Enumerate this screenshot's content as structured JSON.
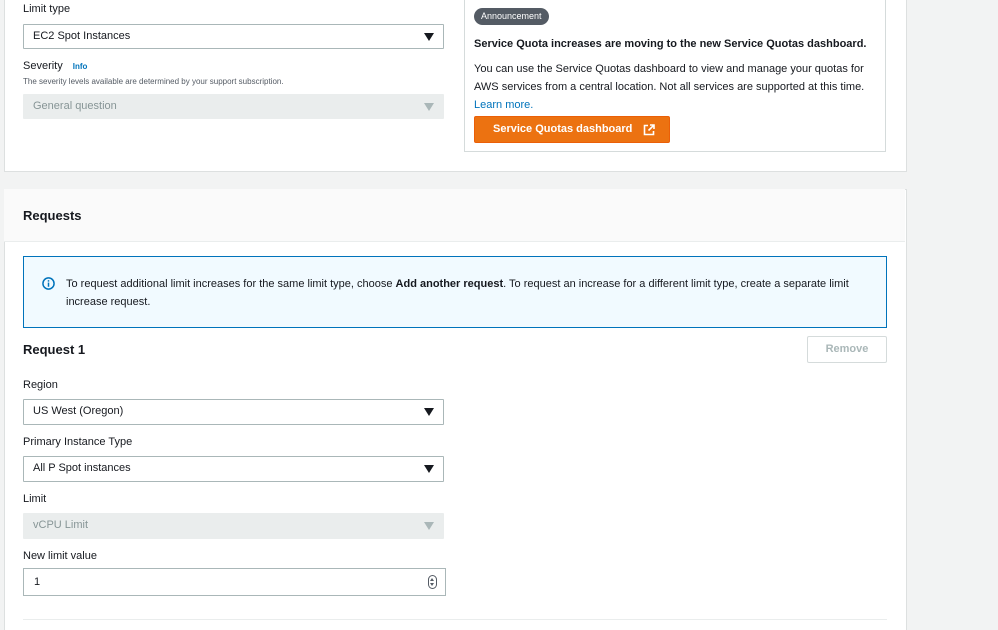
{
  "limit_type": {
    "label": "Limit type",
    "value": "EC2 Spot Instances"
  },
  "severity": {
    "label": "Severity",
    "info": "Info",
    "help": "The severity levels available are determined by your support subscription.",
    "value": "General question"
  },
  "announcement": {
    "badge": "Announcement",
    "title": "Service Quota increases are moving to the new Service Quotas dashboard.",
    "body": "You can use the Service Quotas dashboard to view and manage your quotas for AWS services from a central location. Not all services are supported at this time.",
    "link": "Learn more.",
    "button": "Service Quotas dashboard"
  },
  "requests": {
    "title": "Requests",
    "alert": {
      "before": "To request additional limit increases for the same limit type, choose ",
      "bold": "Add another request",
      "after": ". To request an increase for a different limit type, create a separate limit increase request."
    },
    "request1": {
      "title": "Request 1",
      "remove": "Remove",
      "region_label": "Region",
      "region_value": "US West (Oregon)",
      "instance_label": "Primary Instance Type",
      "instance_value": "All P Spot instances",
      "limit_label": "Limit",
      "limit_value": "vCPU Limit",
      "new_limit_label": "New limit value",
      "new_limit_value": "1"
    }
  },
  "colors": {
    "accent": "#ec7211",
    "link": "#0073bb",
    "alert_bg": "#f1faff"
  }
}
